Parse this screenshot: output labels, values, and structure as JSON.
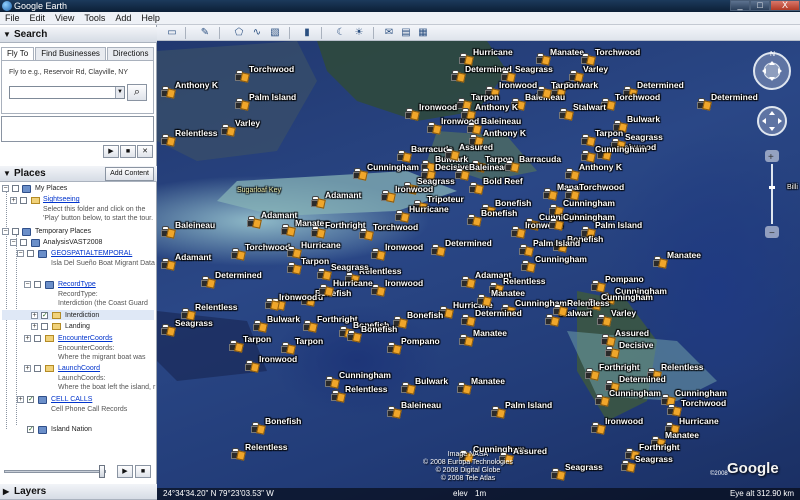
{
  "window": {
    "title": "Google Earth",
    "controls": [
      "_",
      "□",
      "X"
    ]
  },
  "menu": [
    "File",
    "Edit",
    "View",
    "Tools",
    "Add",
    "Help"
  ],
  "search": {
    "header": "Search",
    "tabs": [
      "Fly To",
      "Find Businesses",
      "Directions"
    ],
    "fly_to_hint": "Fly to e.g., Reservoir Rd, Clayville, NY",
    "fly_to_value": ""
  },
  "places": {
    "header": "Places",
    "add_content": "Add Content",
    "items": {
      "my_places": "My Places",
      "sightseeing": "Sightseeing",
      "sightseeing_desc1": "Select this folder and click on the",
      "sightseeing_desc2": "'Play' button below, to start the tour.",
      "temporary_places": "Temporary Places",
      "analysis": "AnalysisVAST2008",
      "geospatial": "GEOSPATIALTEMPORAL",
      "geospatial_desc": "Isla Del Sueño Boat Migrant Data",
      "record_type": "RecordType",
      "record_type_sub1": "RecordType:",
      "record_type_sub2": "Interdiction (the Coast Guard",
      "interdiction": "Interdiction",
      "landing": "Landing",
      "encounter": "EncounterCoords",
      "encounter_sub1": "EncounterCoords:",
      "encounter_sub2": "Where the migrant boat was",
      "launch": "LaunchCoord",
      "launch_sub1": "LaunchCoords:",
      "launch_sub2": "Where the boat left the island, r",
      "cell_calls": "CELL CALLS",
      "cell_calls_sub": "Cell Phone Call Records",
      "island_nation": "Island Nation"
    }
  },
  "layers": {
    "header": "Layers"
  },
  "status": {
    "coords": "24°34'34.20\" N    79°23'03.53\" W",
    "elev": "elev",
    "elev_value": "1m",
    "eye_alt": "Eye alt   312.90 km"
  },
  "credits": [
    "Image NASA",
    "© 2008 Europa Technologies",
    "© 2008 Digital Globe",
    "© 2008 Tele Atlas"
  ],
  "logo": "Google",
  "logo_year": "©2008",
  "map_label_left": "Sugarloaf Key",
  "map_label_right": "Billi",
  "placemarks": [
    {
      "name": "Hurricane"
    },
    {
      "name": "Manatee"
    },
    {
      "name": "Torchwood"
    },
    {
      "name": "Determined"
    },
    {
      "name": "Seagrass"
    },
    {
      "name": "Varley"
    },
    {
      "name": "Anthony K"
    },
    {
      "name": "Torchwood"
    },
    {
      "name": "Ironwood"
    },
    {
      "name": "Bulwark"
    },
    {
      "name": "Determined"
    },
    {
      "name": "Palm Island"
    },
    {
      "name": "Tarpon"
    },
    {
      "name": "Baleineau"
    },
    {
      "name": "Tarpon"
    },
    {
      "name": "Torchwood"
    },
    {
      "name": "Determined"
    },
    {
      "name": "Ironwood"
    },
    {
      "name": "Anthony K"
    },
    {
      "name": "Stalwart"
    },
    {
      "name": "Bulwark"
    },
    {
      "name": "Relentless"
    },
    {
      "name": "Varley"
    },
    {
      "name": "Ironwood"
    },
    {
      "name": "Baleineau"
    },
    {
      "name": "Tarpon"
    },
    {
      "name": "Torchwood"
    },
    {
      "name": "Bulwark"
    },
    {
      "name": "Anthony K"
    },
    {
      "name": "Seagrass"
    },
    {
      "name": "Barracuda"
    },
    {
      "name": "Assured"
    },
    {
      "name": "Tarpon"
    },
    {
      "name": "Cunningham"
    },
    {
      "name": "Cunningham"
    },
    {
      "name": "Decisive"
    },
    {
      "name": "Baleineau"
    },
    {
      "name": "Barracuda"
    },
    {
      "name": "Anthony K"
    },
    {
      "name": "Seagrass"
    },
    {
      "name": "Bold Reef"
    },
    {
      "name": "Manatee"
    },
    {
      "name": "Torchwood"
    },
    {
      "name": "Adamant"
    },
    {
      "name": "Ironwood"
    },
    {
      "name": "Tripoteur"
    },
    {
      "name": "Cunningham"
    },
    {
      "name": "Hurricane"
    },
    {
      "name": "Bonefish"
    },
    {
      "name": "Cunningham"
    },
    {
      "name": "Baleineau"
    },
    {
      "name": "Adamant"
    },
    {
      "name": "Manatee"
    },
    {
      "name": "Forthright"
    },
    {
      "name": "Torchwood"
    },
    {
      "name": "Bonefish"
    },
    {
      "name": "Ironwood"
    },
    {
      "name": "Cunningham"
    },
    {
      "name": "Palm Island"
    },
    {
      "name": "Torchwood"
    },
    {
      "name": "Hurricane"
    },
    {
      "name": "Ironwood"
    },
    {
      "name": "Determined"
    },
    {
      "name": "Bonefish"
    },
    {
      "name": "Adamant"
    },
    {
      "name": "Tarpon"
    },
    {
      "name": "Cunningham"
    },
    {
      "name": "Palm Island"
    },
    {
      "name": "Manatee"
    },
    {
      "name": "Determined"
    },
    {
      "name": "Relentless"
    },
    {
      "name": "Ironwood"
    },
    {
      "name": "Seagrass"
    },
    {
      "name": "Pompano"
    },
    {
      "name": "Adamant"
    },
    {
      "name": "Relentless"
    },
    {
      "name": "Ironwood"
    },
    {
      "name": "Hurricane"
    },
    {
      "name": "Cunningham"
    },
    {
      "name": "Bonefish"
    },
    {
      "name": "Manatee"
    },
    {
      "name": "Stalwart"
    },
    {
      "name": "Cunningham"
    },
    {
      "name": "Relentless"
    },
    {
      "name": "Ironwood"
    },
    {
      "name": "Cunningham"
    },
    {
      "name": "Hurricane"
    },
    {
      "name": "Relentless"
    },
    {
      "name": "Bulwark"
    },
    {
      "name": "Forthright"
    },
    {
      "name": "Determined"
    },
    {
      "name": "Varley"
    },
    {
      "name": "Seagrass"
    },
    {
      "name": "Bonefish"
    },
    {
      "name": "Bonefish"
    },
    {
      "name": "Manatee"
    },
    {
      "name": "Assured"
    },
    {
      "name": "Tarpon"
    },
    {
      "name": "Tarpon"
    },
    {
      "name": "Pompano"
    },
    {
      "name": "Decisive"
    },
    {
      "name": "Ironwood"
    },
    {
      "name": "Bonefish"
    },
    {
      "name": "Forthright"
    },
    {
      "name": "Relentless"
    },
    {
      "name": "Cunningham"
    },
    {
      "name": "Bulwark"
    },
    {
      "name": "Determined"
    },
    {
      "name": "Cunningham"
    },
    {
      "name": "Relentless"
    },
    {
      "name": "Manatee"
    },
    {
      "name": "Cunningham"
    },
    {
      "name": "Torchwood"
    },
    {
      "name": "Baleineau"
    },
    {
      "name": "Palm Island"
    },
    {
      "name": "Bonefish"
    },
    {
      "name": "Ironwood"
    },
    {
      "name": "Hurricane"
    },
    {
      "name": "Relentless"
    },
    {
      "name": "Cunningham"
    },
    {
      "name": "Manatee"
    },
    {
      "name": "Forthright"
    },
    {
      "name": "Assured"
    },
    {
      "name": "Seagrass"
    },
    {
      "name": "Seagrass"
    }
  ]
}
